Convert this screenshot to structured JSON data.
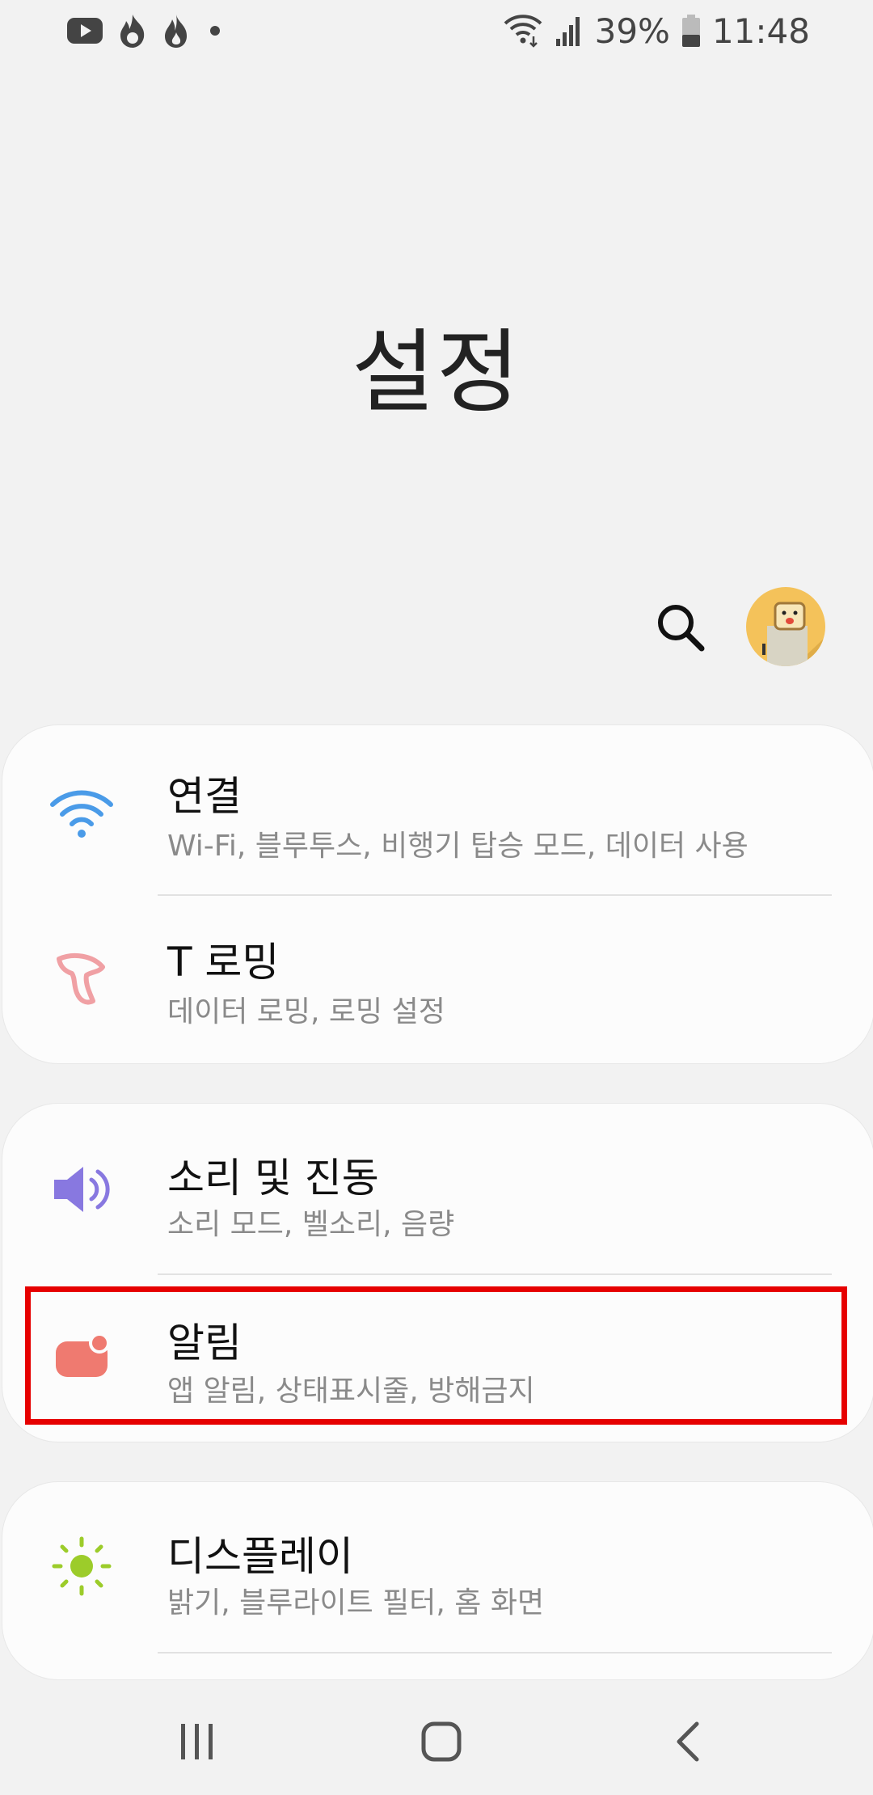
{
  "status_bar": {
    "battery": "39%",
    "time": "11:48",
    "left_icons": [
      "youtube-icon",
      "tinder-flame-icon",
      "flame-icon",
      "dot-icon"
    ]
  },
  "page": {
    "title": "설정"
  },
  "groups": [
    {
      "items": [
        {
          "title": "연결",
          "subtitle": "Wi-Fi, 블루투스, 비행기 탑승 모드, 데이터 사용",
          "icon": "wifi-icon"
        },
        {
          "title": "T 로밍",
          "subtitle": "데이터 로밍, 로밍 설정",
          "icon": "t-roaming-icon"
        }
      ]
    },
    {
      "items": [
        {
          "title": "소리 및 진동",
          "subtitle": "소리 모드, 벨소리, 음량",
          "icon": "speaker-icon"
        },
        {
          "title": "알림",
          "subtitle": "앱 알림, 상태표시줄, 방해금지",
          "icon": "notification-icon"
        }
      ]
    },
    {
      "items": [
        {
          "title": "디스플레이",
          "subtitle": "밝기, 블루라이트 필터, 홈 화면",
          "icon": "brightness-icon"
        }
      ]
    }
  ],
  "colors": {
    "highlight": "#e60000",
    "wifi": "#4a9be8",
    "t_roaming": "#f0a0a4",
    "speaker": "#8878e0",
    "notification": "#ef7a70",
    "brightness": "#9ccc2a"
  }
}
